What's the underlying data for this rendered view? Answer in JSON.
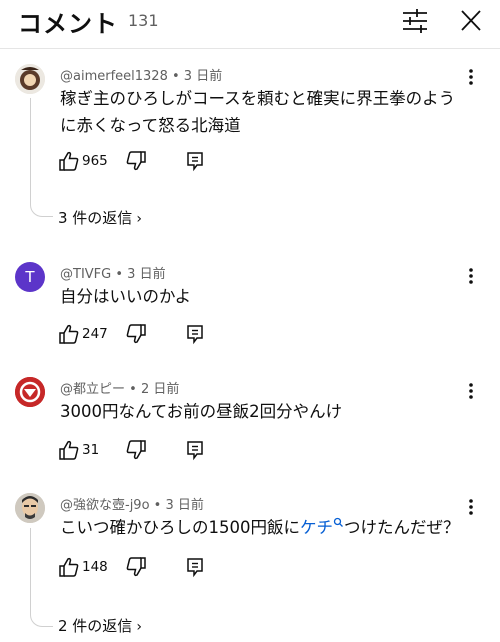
{
  "header": {
    "title": "コメント",
    "count": "131",
    "filter_icon": "sliders-icon",
    "close_icon": "close-icon"
  },
  "comments": [
    {
      "author": "@aimerfeel1328",
      "time": "3 日前",
      "text": "稼ぎ主のひろしがコースを頼むと確実に界王拳のように赤くなって怒る北海道",
      "likes": "965",
      "replies": "3 件の返信"
    },
    {
      "author": "@TIVFG",
      "time": "3 日前",
      "avatar_letter": "T",
      "avatar_color": "#5c35c9",
      "text": "自分はいいのかよ",
      "likes": "247"
    },
    {
      "author": "@都立ピー",
      "time": "2 日前",
      "avatar_color": "#c62828",
      "text": "3000円なんてお前の昼飯2回分やんけ",
      "likes": "31"
    },
    {
      "author": "@強欲な壺-j9o",
      "time": "3 日前",
      "text_before": "こいつ確かひろしの1500円飯に",
      "text_link": "ケチ",
      "text_after": "つけたんだぜ？",
      "likes": "148",
      "replies": "2 件の返信"
    }
  ],
  "separator": " • ",
  "colors": {
    "link": "#065fd4",
    "meta": "#606060",
    "text": "#0f0f0f"
  }
}
